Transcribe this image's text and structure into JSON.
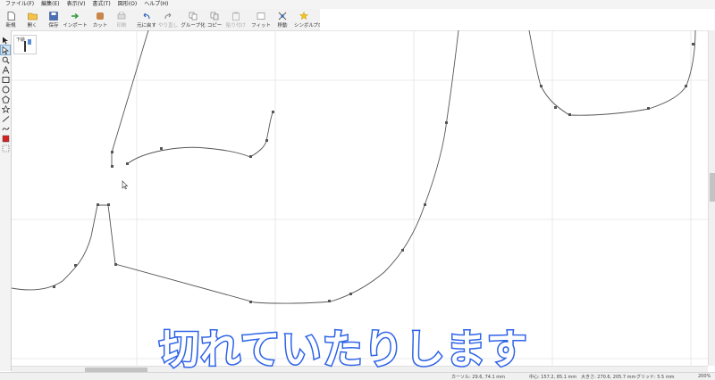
{
  "menubar": [
    "ファイル(F)",
    "編集(E)",
    "表示(V)",
    "書式(T)",
    "図形(O)",
    "ヘルプ(H)"
  ],
  "toolbar": {
    "new": "新規",
    "open": "開く",
    "save": "保存",
    "import": "インポート",
    "cut": "カット",
    "print": "印刷",
    "undo": "元に戻す",
    "redo": "やり直し",
    "group": "グループ化",
    "copy": "コピー",
    "paste": "貼り付け",
    "fit": "フィット",
    "transform": "移動",
    "symbol": "シンボル",
    "properties": "プロパティ"
  },
  "thumbnail": {
    "label": "下絵"
  },
  "caption": "切れていたりします",
  "statusbar": {
    "cursor": "カーソル: 29.6, 74.1 mm",
    "center": "中心: 157.2, 85.1 mm",
    "size": "大きさ: 270.6, 205.7 mm",
    "grid": "グリッド: 5.5 mm",
    "zoom": "200%"
  },
  "colors": {
    "accent": "#2e63e8",
    "grid": "#e4e4e4",
    "path": "#555555"
  }
}
